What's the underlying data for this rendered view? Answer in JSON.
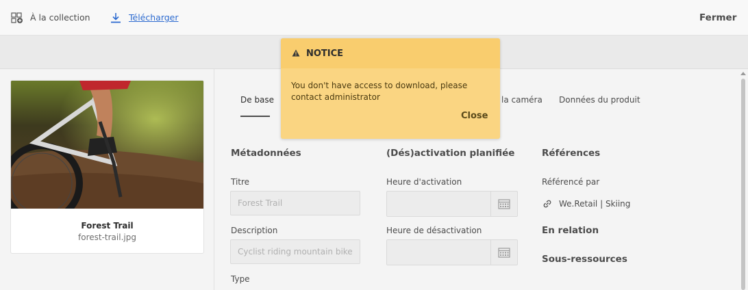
{
  "topbar": {
    "collection_label": "À la collection",
    "download_label": "Télécharger",
    "close_label": "Fermer"
  },
  "asset": {
    "title": "Forest Trail",
    "filename": "forest-trail.jpg"
  },
  "tabs": [
    {
      "label": "De base"
    },
    {
      "label": "la caméra"
    },
    {
      "label": "Données du produit"
    }
  ],
  "metadata": {
    "heading": "Métadonnées",
    "title_label": "Titre",
    "title_value": "Forest Trail",
    "description_label": "Description",
    "description_value": "Cyclist riding mountain bike on r",
    "type_label": "Type"
  },
  "scheduling": {
    "heading": "(Dés)activation planifiée",
    "on_label": "Heure d'activation",
    "off_label": "Heure de désactivation"
  },
  "references": {
    "heading": "Références",
    "referenced_by_label": "Référencé par",
    "link_text": "We.Retail | Skiing",
    "related_heading": "En relation",
    "subassets_heading": "Sous-ressources"
  },
  "notice": {
    "title": "NOTICE",
    "message": "You don't have access to download, please contact administrator",
    "close_label": "Close"
  },
  "colors": {
    "notice_bg": "#fad582",
    "notice_header": "#f9cd6e",
    "link_blue": "#2d6bd0"
  }
}
